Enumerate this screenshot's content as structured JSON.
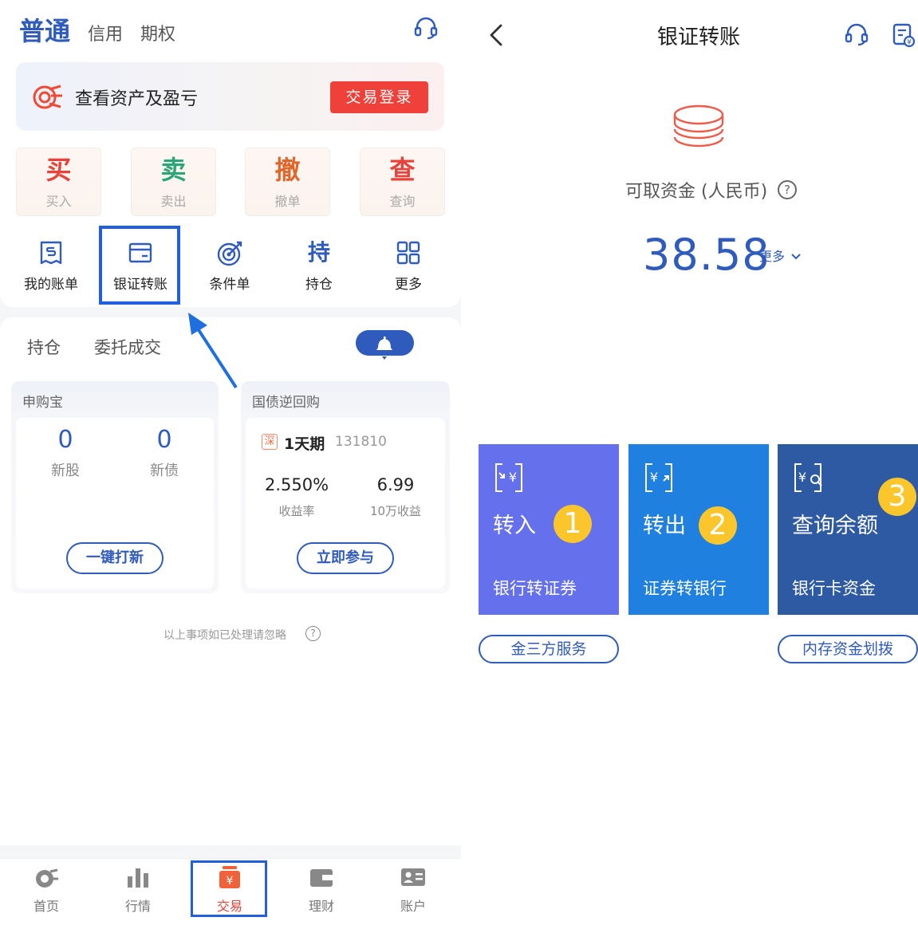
{
  "left": {
    "tabs": [
      "普通",
      "信用",
      "期权"
    ],
    "banner": {
      "text": "查看资产及盈亏",
      "button": "交易登录"
    },
    "trade_actions": [
      {
        "big": "买",
        "small": "买入",
        "color": "#e8423a"
      },
      {
        "big": "卖",
        "small": "卖出",
        "color": "#2ca57b"
      },
      {
        "big": "撤",
        "small": "撤单",
        "color": "#e0662b"
      },
      {
        "big": "查",
        "small": "查询",
        "color": "#e8423a"
      }
    ],
    "functions": [
      {
        "label": "我的账单",
        "icon": "bill-icon"
      },
      {
        "label": "银证转账",
        "icon": "bank-card-icon"
      },
      {
        "label": "条件单",
        "icon": "target-icon"
      },
      {
        "label": "持仓",
        "icon": "hold-icon"
      },
      {
        "label": "更多",
        "icon": "grid-icon"
      }
    ],
    "hold_icon_glyph": "持",
    "mid_tabs": [
      "持仓",
      "委托成交"
    ],
    "ipo": {
      "title": "申购宝",
      "new_stock_count": "0",
      "new_stock_label": "新股",
      "new_bond_count": "0",
      "new_bond_label": "新债",
      "button": "一键打新"
    },
    "repo": {
      "title": "国债逆回购",
      "badge": "深",
      "term": "1天期",
      "code": "131810",
      "rate": "2.550%",
      "rate_label": "收益率",
      "income": "6.99",
      "income_label": "10万收益",
      "button": "立即参与"
    },
    "notice": "以上事项如已处理请忽略",
    "tabbar": [
      {
        "label": "首页",
        "icon": "home-icon"
      },
      {
        "label": "行情",
        "icon": "market-icon"
      },
      {
        "label": "交易",
        "icon": "trade-icon",
        "active": true
      },
      {
        "label": "理财",
        "icon": "wallet-icon"
      },
      {
        "label": "账户",
        "icon": "account-icon"
      }
    ]
  },
  "right": {
    "title": "银证转账",
    "available_label": "可取资金 (人民币)",
    "amount": "38.58",
    "more": "更多",
    "actions": [
      {
        "name": "转入",
        "desc": "银行转证券",
        "step": "1",
        "color": "#6470ec",
        "icon": "transfer-in-icon"
      },
      {
        "name": "转出",
        "desc": "证券转银行",
        "step": "2",
        "color": "#1f80e0",
        "icon": "transfer-out-icon"
      },
      {
        "name": "查询余额",
        "desc": "银行卡资金",
        "step": "3",
        "color": "#2e5aa3",
        "icon": "balance-query-icon"
      }
    ],
    "buttons": [
      "金三方服务",
      "内存资金划拨"
    ]
  },
  "colors": {
    "brand": "#2f5bbd",
    "highlight": "#1f5fe0",
    "red": "#f0403a",
    "badge": "#fbc62c"
  }
}
